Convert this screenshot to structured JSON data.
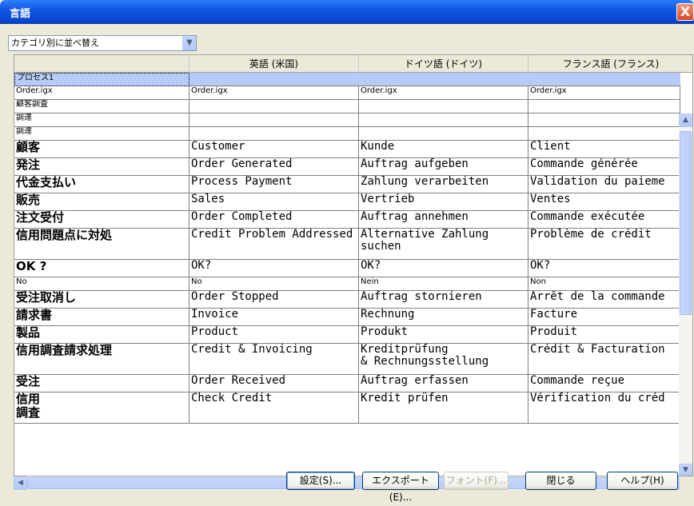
{
  "window": {
    "title": "言語",
    "close_label": "X"
  },
  "sort_select": {
    "value": "カテゴリ別に並べ替え"
  },
  "columns": [
    "",
    "英語 (米国)",
    "ドイツ語 (ドイツ)",
    "フランス語 (フランス)"
  ],
  "rows": [
    {
      "name": "プロセス1",
      "values": [],
      "group": true,
      "size": "small"
    },
    {
      "name": "Order.igx",
      "values": [
        "Order.igx",
        "Order.igx",
        "Order.igx"
      ],
      "size": "small"
    },
    {
      "name": "顧客調査",
      "values": [
        "",
        "",
        ""
      ],
      "size": "small"
    },
    {
      "name": "調達",
      "values": [
        "",
        "",
        ""
      ],
      "size": "small"
    },
    {
      "name": "調達",
      "values": [
        "",
        "",
        ""
      ],
      "size": "small"
    },
    {
      "name": "顧客",
      "values": [
        "Customer",
        "Kunde",
        "Client"
      ],
      "size": "large"
    },
    {
      "name": "発注",
      "values": [
        "Order Generated",
        "Auftrag aufgeben",
        "Commande générée"
      ],
      "size": "large"
    },
    {
      "name": "代金支払い",
      "values": [
        "Process Payment",
        "Zahlung verarbeiten",
        "Validation du paieme"
      ],
      "size": "large"
    },
    {
      "name": "販売",
      "values": [
        "Sales",
        "Vertrieb",
        "Ventes"
      ],
      "size": "large"
    },
    {
      "name": "注文受付",
      "values": [
        "Order Completed",
        "Auftrag annehmen",
        "Commande exécutée"
      ],
      "size": "large"
    },
    {
      "name": "信用問題点に対処",
      "values": [
        "Credit Problem Addressed",
        "Alternative Zahlung\nsuchen",
        "Problème de crédit"
      ],
      "size": "large",
      "tall": true
    },
    {
      "name": "OK ?",
      "values": [
        "OK?",
        "OK?",
        "OK?"
      ],
      "size": "large"
    },
    {
      "name": "No",
      "values": [
        "No",
        "Nein",
        "Non"
      ],
      "size": "small"
    },
    {
      "name": "受注取消し",
      "values": [
        "Order Stopped",
        "Auftrag stornieren",
        "Arrêt de la commande"
      ],
      "size": "large"
    },
    {
      "name": "請求書",
      "values": [
        "Invoice",
        "Rechnung",
        "Facture"
      ],
      "size": "large"
    },
    {
      "name": "製品",
      "values": [
        "Product",
        "Produkt",
        "Produit"
      ],
      "size": "large"
    },
    {
      "name": "信用調査請求処理",
      "values": [
        "Credit & Invoicing",
        "Kreditprüfung\n& Rechnungsstellung",
        "Crédit & Facturation"
      ],
      "size": "large",
      "tall": true
    },
    {
      "name": "受注",
      "values": [
        "Order Received",
        "Auftrag erfassen",
        "Commande reçue"
      ],
      "size": "large"
    },
    {
      "name": "信用\n調査",
      "values": [
        "Check Credit",
        "Kredit prüfen",
        "Vérification du créd"
      ],
      "size": "large",
      "tall": true
    }
  ],
  "buttons": {
    "settings": "設定(S)...",
    "export": "エクスポート(E)...",
    "font": "フォント(F)...",
    "close": "閉じる",
    "help": "ヘルプ(H)"
  }
}
